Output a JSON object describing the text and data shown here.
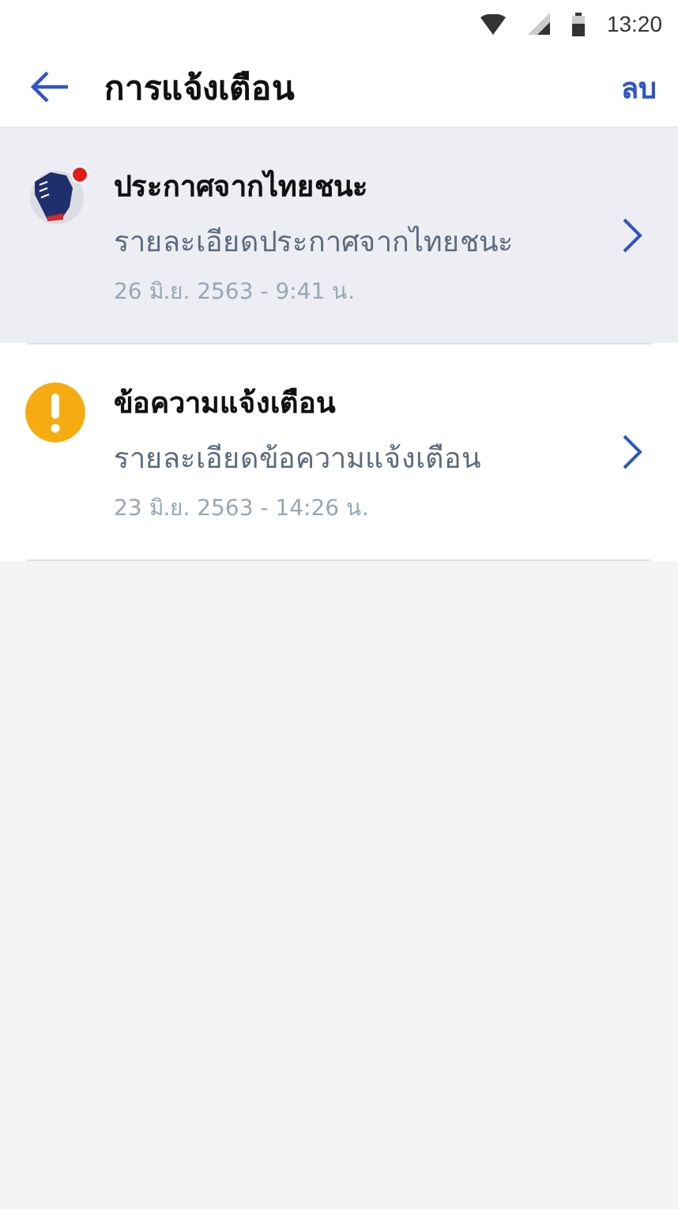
{
  "status_bar": {
    "time": "13:20"
  },
  "header": {
    "title": "การแจ้งเตือน",
    "action": "ลบ"
  },
  "notifications": [
    {
      "kind": "fist",
      "unread": true,
      "title": "ประกาศจากไทยชนะ",
      "detail": "รายละเอียดประกาศจากไทยชนะ",
      "time": "26 มิ.ย. 2563 - 9:41 น."
    },
    {
      "kind": "warning",
      "unread": false,
      "title": "ข้อความแจ้งเตือน",
      "detail": "รายละเอียดข้อความแจ้งเตือน",
      "time": "23 มิ.ย. 2563 - 14:26 น."
    }
  ]
}
